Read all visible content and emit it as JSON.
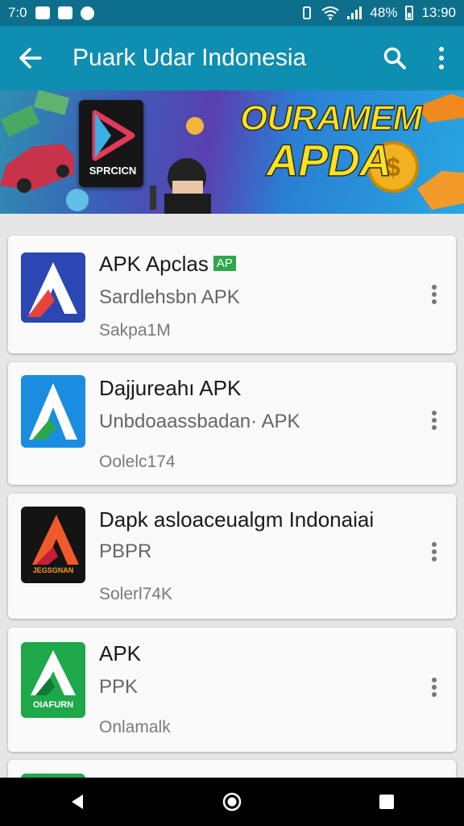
{
  "status_bar": {
    "left_text": "7:0",
    "battery": "48%",
    "time": "13:90"
  },
  "app_bar": {
    "title": "Puark Udar Indonesia",
    "back_icon": "arrow-left-icon",
    "search_icon": "search-icon",
    "menu_icon": "more-vert-icon"
  },
  "banner": {
    "logo_text": "SPRCICN",
    "headline_line1": "OURAMEM",
    "headline_line2": "APDA"
  },
  "apps": [
    {
      "title": "APK Apclas",
      "badge": "AP",
      "subtitle": "Sardlehsbn APK",
      "meta": "Sakpa1M",
      "icon_bg": "#2a47b3",
      "icon_accent": "#e8433a"
    },
    {
      "title": "Dajjureahı APK",
      "subtitle": "Unbdoaassbadan· APK",
      "meta": "Oolelc174",
      "icon_bg": "#1a8de0",
      "icon_accent": "#2aa84a"
    },
    {
      "title": "Dapk asloaceualgm Indonaiai",
      "subtitle": "PBPR",
      "meta": "Solerl74K",
      "icon_bg": "#141414",
      "icon_accent": "#f05a2a",
      "icon_text": "JEGSGNAN"
    },
    {
      "title": "APK",
      "subtitle": "PPK",
      "meta": "Onlamalk",
      "icon_bg": "#1fa84a",
      "icon_accent": "#ffffff",
      "icon_text": "OIAFURN"
    }
  ],
  "nav_bar": {
    "back_icon": "nav-back-triangle-icon",
    "home_icon": "nav-home-circle-icon",
    "recents_icon": "nav-recents-square-icon"
  }
}
